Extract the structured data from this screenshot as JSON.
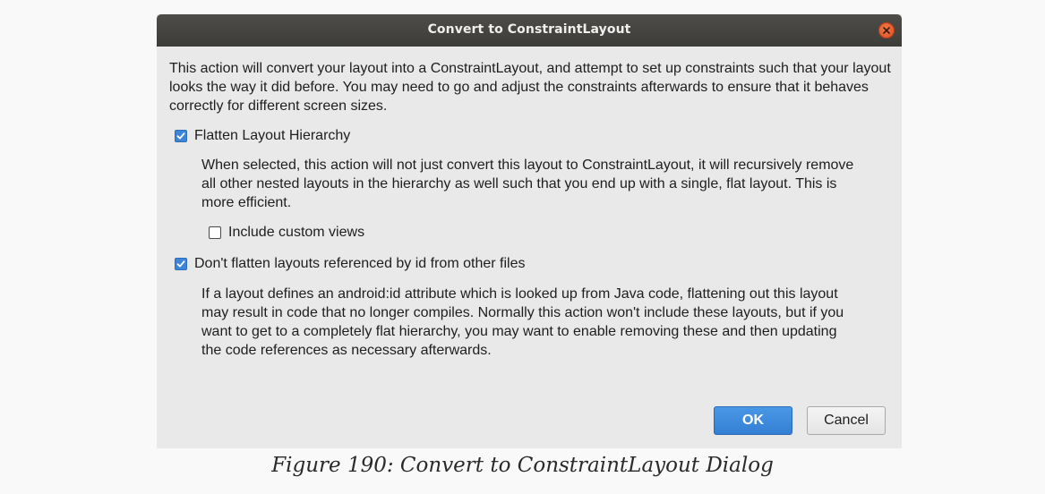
{
  "dialog": {
    "title": "Convert to ConstraintLayout",
    "intro": "This action will convert your layout into a ConstraintLayout, and attempt to set up constraints such that your layout looks the way it did before. You may need to go and adjust the constraints afterwards to ensure that it behaves correctly for different screen sizes.",
    "options": [
      {
        "label": "Flatten Layout Hierarchy",
        "checked": true,
        "description": "When selected, this action will not just convert this layout to ConstraintLayout, it will recursively remove all other nested layouts in the hierarchy as well such that you end up with a single, flat layout. This is more efficient."
      },
      {
        "label": "Include custom views",
        "checked": false
      },
      {
        "label": "Don't flatten layouts referenced by id from other files",
        "checked": true,
        "description": "If a layout defines an android:id attribute which is looked up from Java code, flattening out this layout may result in code that no longer compiles. Normally this action won't include these layouts, but if you want to get to a completely flat hierarchy, you may want to enable removing these and then updating the code references as necessary afterwards."
      }
    ],
    "ok_label": "OK",
    "cancel_label": "Cancel",
    "close_icon": "close-icon"
  },
  "caption": "Figure 190: Convert to ConstraintLayout Dialog",
  "colors": {
    "accent": "#3d85d8",
    "titlebar": "#46453f",
    "close": "#e0562a",
    "dialog_bg": "#e9e9e9"
  }
}
